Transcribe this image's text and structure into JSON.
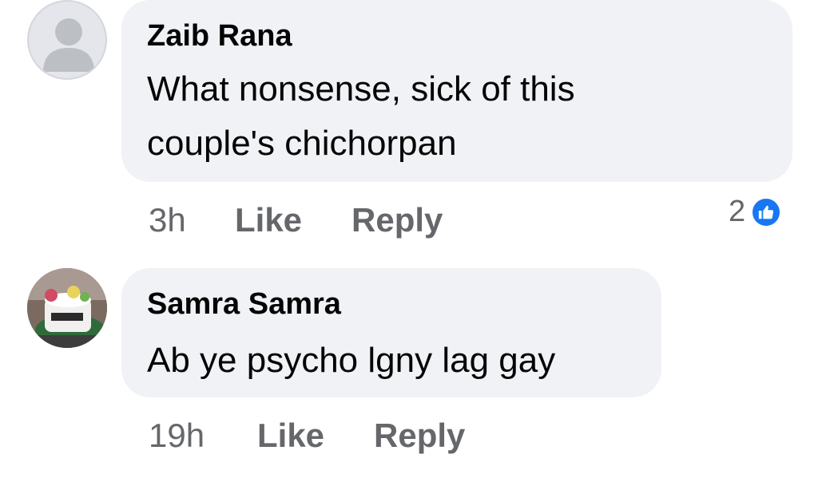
{
  "comments": [
    {
      "author": "Zaib Rana",
      "text_lines": [
        "What nonsense, sick of this",
        "couple's chichorpan"
      ],
      "time": "3h",
      "like_label": "Like",
      "reply_label": "Reply",
      "reaction_count": "2",
      "reaction_icon": "like-icon",
      "avatar": "default-avatar-icon"
    },
    {
      "author": "Samra Samra",
      "text_lines": [
        "Ab ye psycho lgny lag gay"
      ],
      "time": "19h",
      "like_label": "Like",
      "reply_label": "Reply",
      "avatar": "profile-photo-cake"
    }
  ],
  "colors": {
    "bubble": "#f0f2f5",
    "text": "#050505",
    "meta": "#65676b",
    "like_blue": "#1877f2"
  }
}
